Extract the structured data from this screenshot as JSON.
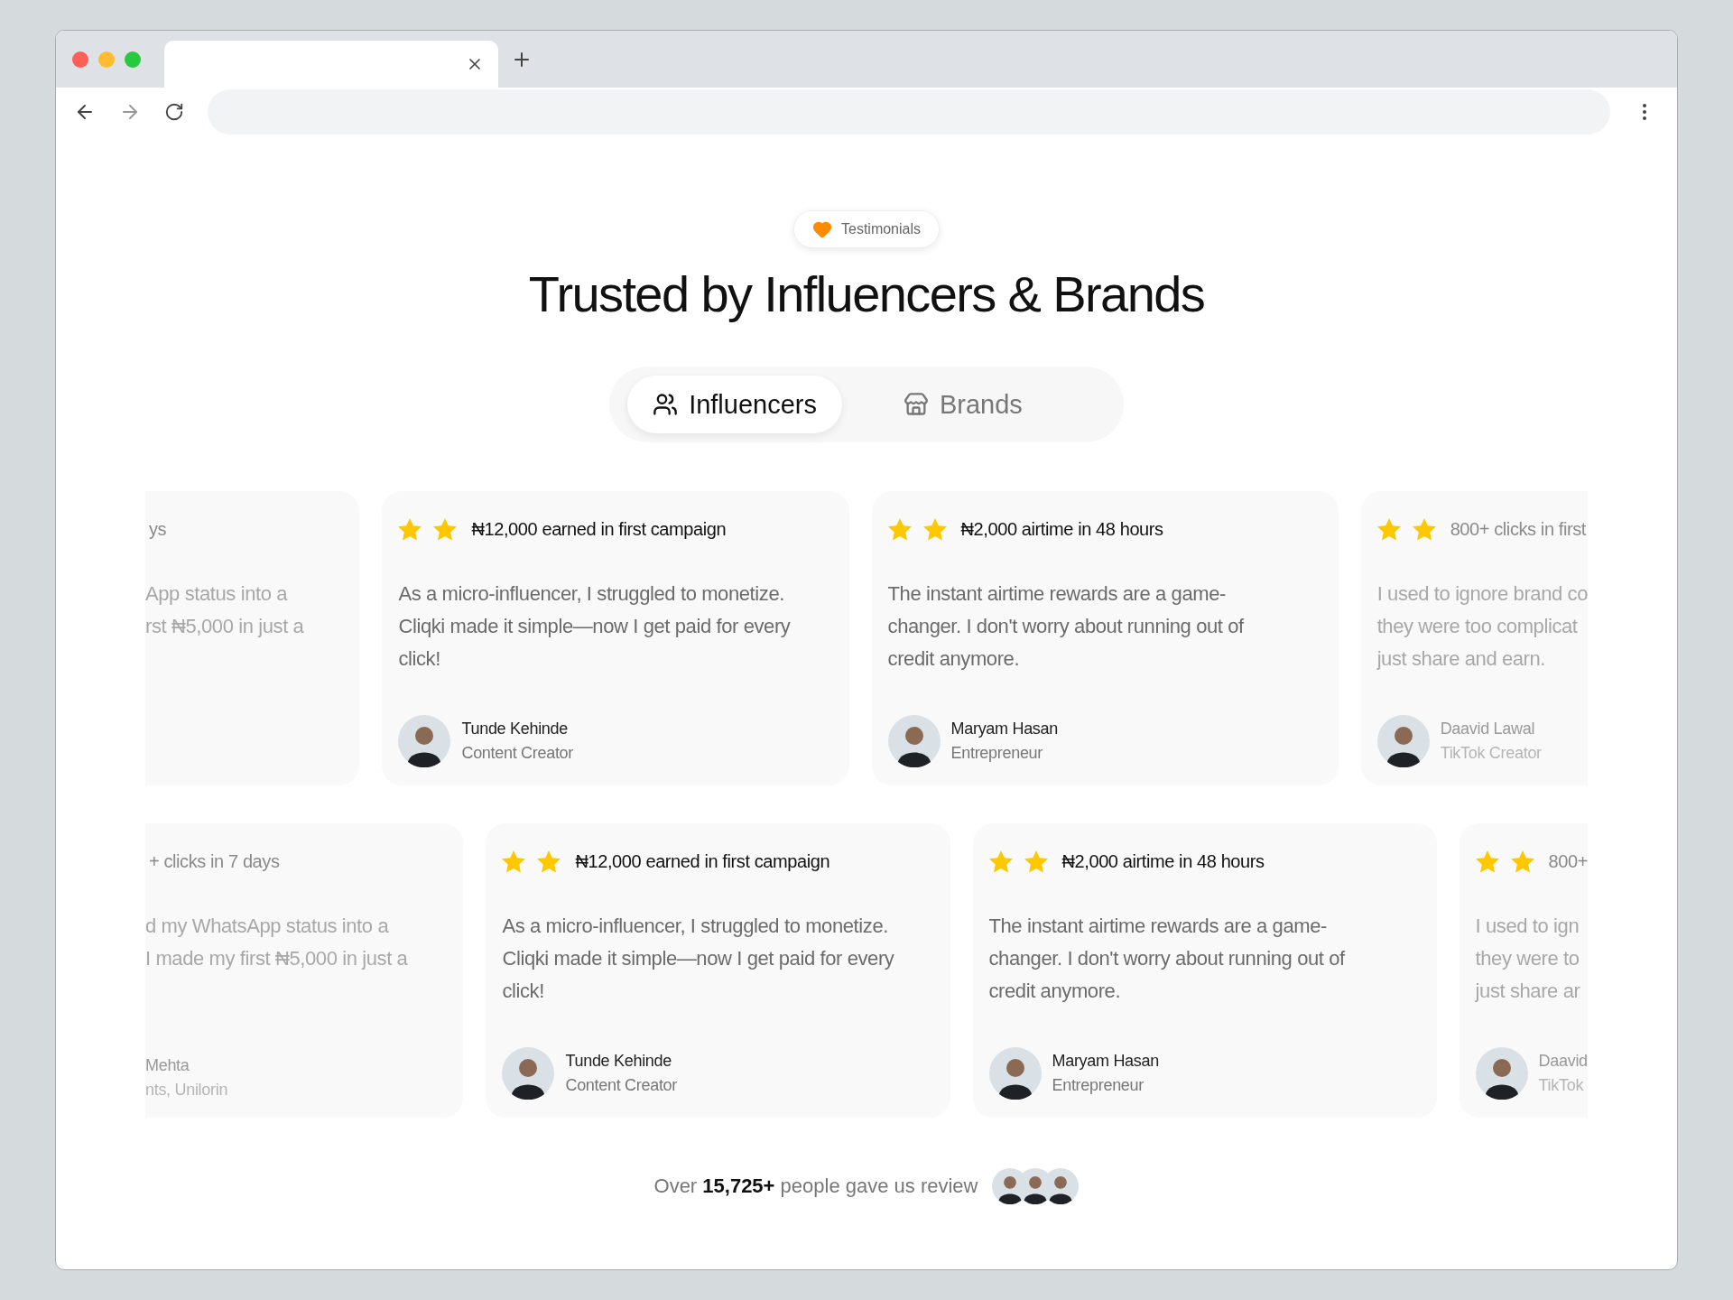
{
  "badge": {
    "label": "Testimonials"
  },
  "title": "Trusted by Influencers & Brands",
  "tabs": [
    {
      "label": "Influencers",
      "selected": true
    },
    {
      "label": "Brands",
      "selected": false
    }
  ],
  "rows": [
    {
      "cards": [
        {
          "kind": "partial-start",
          "headline": "ys",
          "lines": [
            "App status into a",
            "rst ₦5,000 in just a"
          ]
        },
        {
          "kind": "full",
          "headline": "₦12,000 earned in first campaign",
          "body": "As a micro-influencer, I struggled to monetize. Cliqki made it simple—now I get paid for every click!",
          "author": {
            "name": "Tunde Kehinde",
            "role": "Content Creator"
          }
        },
        {
          "kind": "full",
          "headline": "₦2,000 airtime in 48 hours",
          "body": "The instant airtime rewards are a game-changer. I don't worry about running out of credit anymore.",
          "author": {
            "name": "Maryam Hasan",
            "role": "Entrepreneur"
          }
        },
        {
          "kind": "partial-end",
          "headline": "800+ clicks in first",
          "lines": [
            "I used to ignore brand co",
            "they were too complicat",
            "just share and earn."
          ],
          "author": {
            "name": "Daavid Lawal",
            "role": "TikTok Creator"
          }
        }
      ]
    },
    {
      "cards": [
        {
          "kind": "partial-start",
          "headline": "+ clicks in 7 days",
          "lines": [
            "d my WhatsApp status into a",
            "I made my first ₦5,000 in just a"
          ],
          "author": {
            "name": "Mehta",
            "role": "nts, Unilorin"
          }
        },
        {
          "kind": "full",
          "headline": "₦12,000 earned in first campaign",
          "body": "As a micro-influencer, I struggled to monetize. Cliqki made it simple—now I get paid for every click!",
          "author": {
            "name": "Tunde Kehinde",
            "role": "Content Creator"
          }
        },
        {
          "kind": "full",
          "headline": "₦2,000 airtime in 48 hours",
          "body": "The instant airtime rewards are a game-changer. I don't worry about running out of credit anymore.",
          "author": {
            "name": "Maryam Hasan",
            "role": "Entrepreneur"
          }
        },
        {
          "kind": "partial-end",
          "headline": "800+",
          "lines": [
            "I used to ign",
            "they were to",
            "just share ar"
          ],
          "author": {
            "name": "Daavid",
            "role": "TikTok"
          }
        }
      ]
    }
  ],
  "footer": {
    "text": "Over **15,725+** people gave us review"
  }
}
